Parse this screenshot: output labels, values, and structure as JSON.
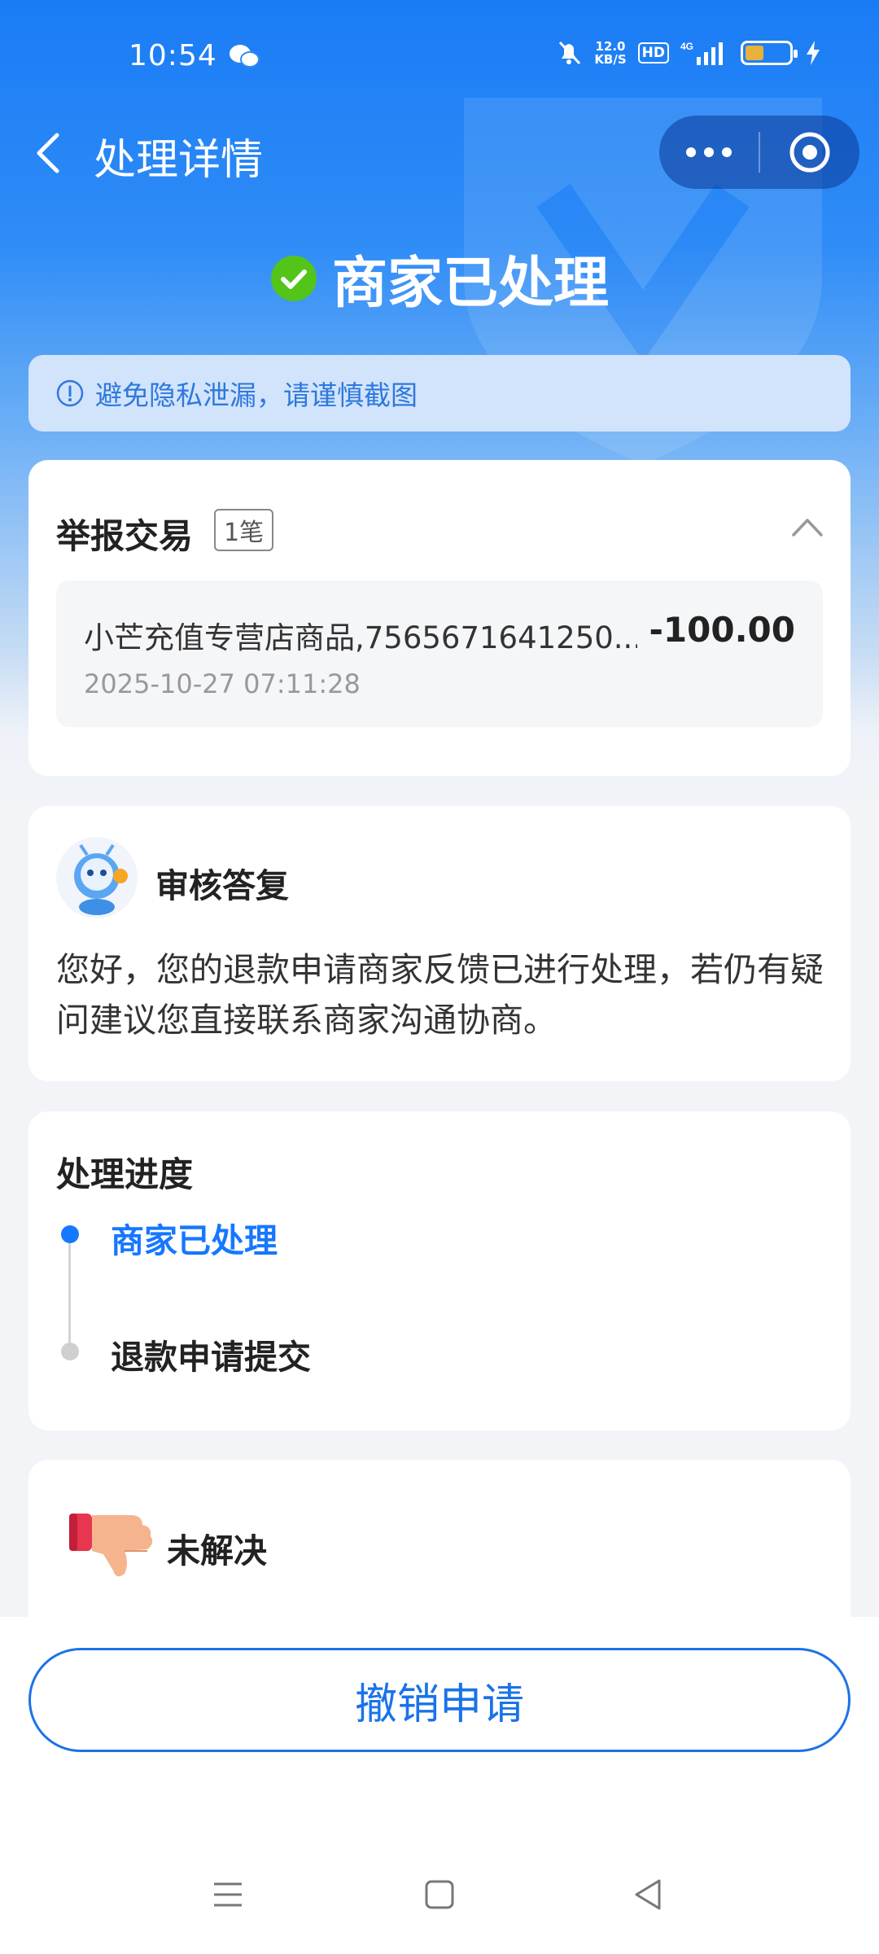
{
  "status_bar": {
    "time": "10:54",
    "net_speed_value": "12.0",
    "net_speed_unit": "KB/S",
    "hd_label": "HD",
    "network_label": "4G",
    "icons": [
      "wechat-icon",
      "mute-bell-icon",
      "signal-icon",
      "battery-icon",
      "charging-icon"
    ],
    "battery_color": "#e6b23c"
  },
  "header": {
    "title": "处理详情",
    "back_icon": "chevron-left-icon",
    "more_icon": "more-dots-icon",
    "target_icon": "target-icon"
  },
  "status": {
    "text": "商家已处理",
    "icon": "check-circle-icon",
    "icon_color": "#52c41a"
  },
  "tip": {
    "icon": "info-icon",
    "text": "避免隐私泄漏，请谨慎截图"
  },
  "report": {
    "title": "举报交易",
    "count": "1笔",
    "item": {
      "name": "小芒充值专营店商品,7565671641250...",
      "amount": "-100.00",
      "time": "2025-10-27 07:11:28"
    }
  },
  "reply": {
    "title": "审核答复",
    "body": "您好，您的退款申请商家反馈已进行处理，若仍有疑问建议您直接联系商家沟通协商。"
  },
  "progress": {
    "title": "处理进度",
    "steps": [
      {
        "label": "商家已处理",
        "state": "active"
      },
      {
        "label": "退款申请提交",
        "state": "done"
      }
    ],
    "active_color": "#1677ff"
  },
  "feedback": {
    "label": "未解决",
    "icon": "thumbs-down-icon"
  },
  "action": {
    "revoke_label": "撤销申请",
    "color": "#1a73e8"
  },
  "colors": {
    "brand_blue": "#1a7cf5"
  }
}
